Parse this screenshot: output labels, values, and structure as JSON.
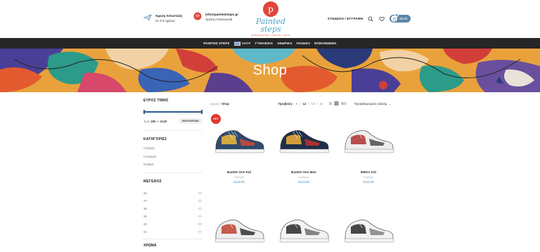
{
  "header": {
    "info1": {
      "title": "Άμεση Αποστολή",
      "sub": "Σε 4-6 ημέρες"
    },
    "info2": {
      "title": "info@paintedsteps.gr",
      "sub": "Άμεση επικοινωνία"
    },
    "logo": {
      "mark": "p",
      "name": "Painted steps",
      "tagline": "HANDCRAFTED • PRINTS • PAINT"
    },
    "login": "ΣΥΝΔΕΣΗ / ΕΓΓΡΑΦΗ",
    "cart_total": "€0.00",
    "cart_count": "0"
  },
  "nav": {
    "items": [
      {
        "label": "PAINTED STEPS"
      },
      {
        "label": "SHOP"
      },
      {
        "label": "ΓΥΝΑΙΚΕΙΑ"
      },
      {
        "label": "ΑΝΔΡΙΚΑ"
      },
      {
        "label": "ΠΑΙΔΙΚΑ"
      },
      {
        "label": "ΕΠΙΚΟΙΝΩΝΙΑ"
      }
    ]
  },
  "banner": {
    "title": "Shop"
  },
  "sidebar": {
    "price": {
      "title": "ΕΥΡΟΣ ΤΙΜΗΣ",
      "label": "Τιμή:",
      "range": "€90 — €120",
      "button": "ΦΙΛΤΡΑΡΙΣΜΑ",
      "min": 90,
      "max": 120
    },
    "categories": {
      "title": "ΚΑΤΗΓΟΡΙΕΣ",
      "items": [
        "Ανδρικά",
        "Γυναικεία",
        "Παιδικά"
      ]
    },
    "sizes": {
      "title": "ΜΕΓΕΘΟΣ",
      "items": [
        {
          "size": "36",
          "count": "24"
        },
        {
          "size": "37",
          "count": "24"
        },
        {
          "size": "38",
          "count": "24"
        },
        {
          "size": "39",
          "count": "24"
        },
        {
          "size": "40",
          "count": "24"
        },
        {
          "size": "41",
          "count": "23"
        }
      ]
    },
    "more_title": "ΧΡΩΜΑ"
  },
  "main": {
    "breadcrumb": {
      "home": "Αρχική",
      "sep": " / ",
      "current": "Shop"
    },
    "per_page": {
      "label": "Προβολή :",
      "options": [
        "9",
        "12",
        "18",
        "24"
      ],
      "selected": "12"
    },
    "sort": {
      "label": "Προκαθορισμένη ταξινόμ",
      "arrow": "⌄"
    },
    "products": [
      {
        "title": "Basket One Kid",
        "category": "Παιδικά",
        "price": "€119.00",
        "badge": "HOT",
        "colors": [
          "#2f4a6e",
          "#e7b33d",
          "#c94a3a"
        ]
      },
      {
        "title": "Basket One Man",
        "category": "Ανδρικά",
        "price": "€119.00",
        "badge": "",
        "colors": [
          "#1f2f4a",
          "#e6a93a",
          "#b8322e"
        ]
      },
      {
        "title": "BBies Kid",
        "category": "Παιδικά",
        "price": "€119.00",
        "badge": "",
        "colors": [
          "#eeeeee",
          "#b23a3a",
          "#555555"
        ]
      },
      {
        "title": "",
        "category": "",
        "price": "",
        "badge": "",
        "colors": [
          "#eeeeee",
          "#c24a3a",
          "#3a3a3a"
        ]
      },
      {
        "title": "",
        "category": "",
        "price": "",
        "badge": "",
        "colors": [
          "#f2f2f2",
          "#333333",
          "#777777"
        ]
      },
      {
        "title": "",
        "category": "",
        "price": "",
        "badge": "",
        "colors": [
          "#f2f2f2",
          "#333333",
          "#888888"
        ]
      }
    ]
  },
  "colors": {
    "accent": "#4a89b8",
    "nav_bg": "#262626",
    "hot": "#e0362e",
    "slider": "#2c5a8a"
  }
}
